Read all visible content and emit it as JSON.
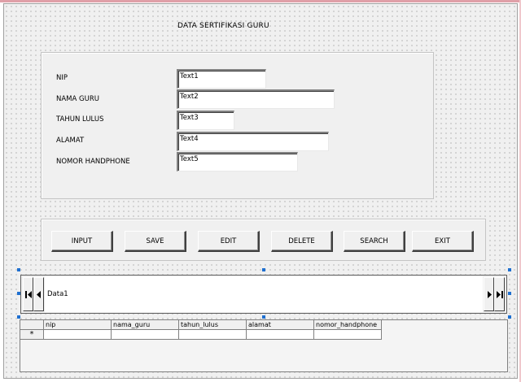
{
  "form": {
    "title": "DATA SERTIFIKASI GURU"
  },
  "fields": [
    {
      "label": "NIP",
      "value": "Text1"
    },
    {
      "label": "NAMA GURU",
      "value": "Text2"
    },
    {
      "label": "TAHUN LULUS",
      "value": "Text3"
    },
    {
      "label": "ALAMAT",
      "value": "Text4"
    },
    {
      "label": "NOMOR HANDPHONE",
      "value": "Text5"
    }
  ],
  "buttons": [
    "INPUT",
    "SAVE",
    "EDIT",
    "DELETE",
    "SEARCH",
    "EXIT"
  ],
  "data_control": {
    "caption": "Data1",
    "nav_icons": [
      "first-record-icon",
      "previous-record-icon",
      "next-record-icon",
      "last-record-icon"
    ]
  },
  "grid": {
    "columns": [
      "nip",
      "nama_guru",
      "tahun_lulus",
      "alamat",
      "nomor_handphone"
    ],
    "new_row_marker": "*"
  },
  "colors": {
    "selection_handle": "#1e6fd0",
    "form_background": "#f0f0f0"
  }
}
